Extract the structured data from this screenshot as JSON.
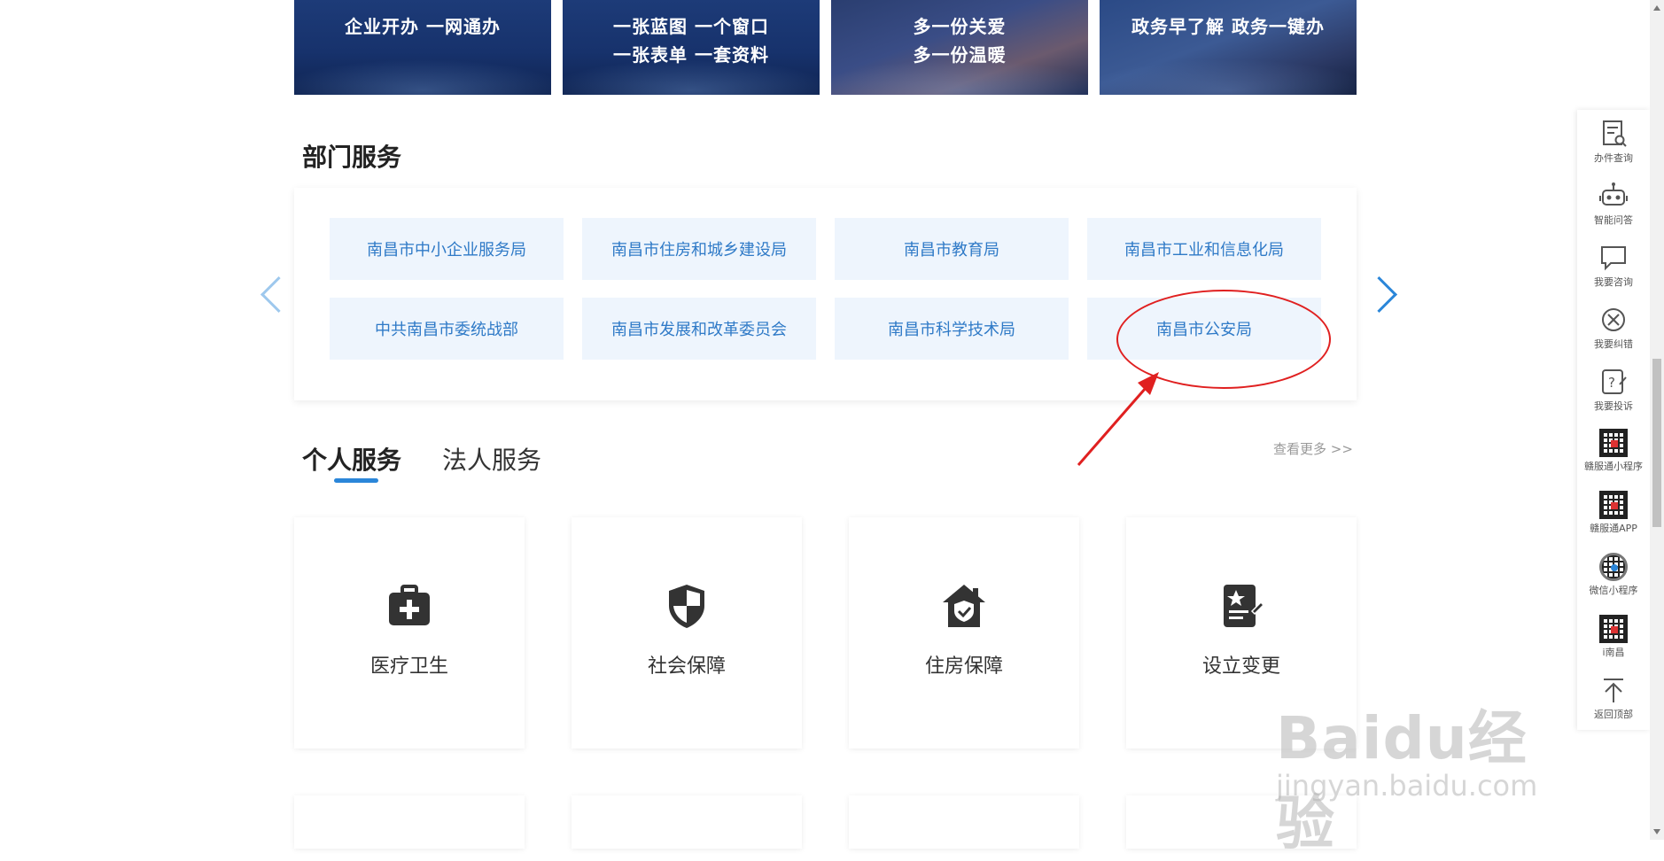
{
  "banners": [
    {
      "lines": [
        "企业开办 一网通办"
      ]
    },
    {
      "lines": [
        "一张蓝图 一个窗口",
        "一张表单 一套资料"
      ]
    },
    {
      "lines": [
        "多一份关爱",
        "多一份温暖"
      ]
    },
    {
      "lines": [
        "政务早了解 政务一键办"
      ]
    }
  ],
  "dept_section": {
    "title": "部门服务",
    "departments": [
      "南昌市中小企业服务局",
      "南昌市住房和城乡建设局",
      "南昌市教育局",
      "南昌市工业和信息化局",
      "中共南昌市委统战部",
      "南昌市发展和改革委员会",
      "南昌市科学技术局",
      "南昌市公安局"
    ]
  },
  "service_tabs": {
    "tabs": [
      "个人服务",
      "法人服务"
    ],
    "active": "个人服务",
    "more_link": "查看更多 >>"
  },
  "service_cards": [
    {
      "label": "医疗卫生",
      "icon": "medical-kit-icon"
    },
    {
      "label": "社会保障",
      "icon": "shield-icon"
    },
    {
      "label": "住房保障",
      "icon": "house-shield-icon"
    },
    {
      "label": "设立变更",
      "icon": "document-star-icon"
    }
  ],
  "sidebar": {
    "items": [
      {
        "label": "办件查询",
        "icon": "document-search-icon"
      },
      {
        "label": "智能问答",
        "icon": "robot-icon"
      },
      {
        "label": "我要咨询",
        "icon": "chat-bubble-icon"
      },
      {
        "label": "我要纠错",
        "icon": "error-circle-icon"
      },
      {
        "label": "我要投诉",
        "icon": "complaint-icon"
      },
      {
        "label": "赣服通小程序",
        "icon": "qr-code-icon"
      },
      {
        "label": "赣服通APP",
        "icon": "qr-code-icon"
      },
      {
        "label": "微信小程序",
        "icon": "mini-program-code-icon"
      },
      {
        "label": "i南昌",
        "icon": "qr-code-icon"
      },
      {
        "label": "返回顶部",
        "icon": "back-to-top-icon"
      }
    ]
  },
  "watermark": {
    "big": "Baidu经验",
    "small": "jingyan.baidu.com"
  },
  "colors": {
    "accent": "#2b86d9",
    "dept_bg": "#eef5fd",
    "dept_text": "#2f7ac7",
    "annotation": "#e02020"
  }
}
